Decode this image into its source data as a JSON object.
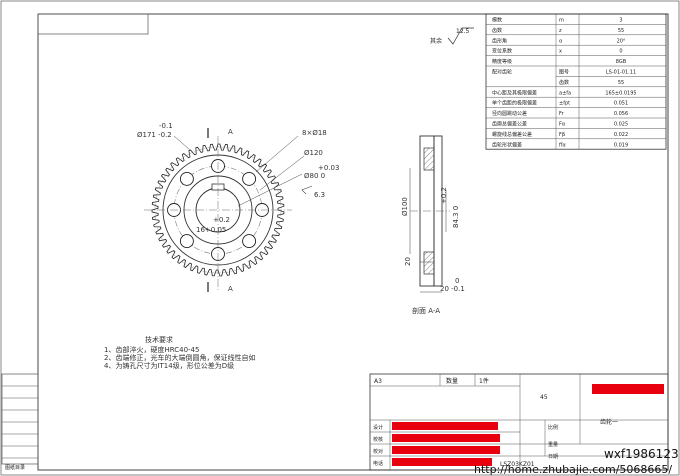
{
  "params": {
    "rows": [
      {
        "name": "模数",
        "sym": "m",
        "val": "3"
      },
      {
        "name": "齿数",
        "sym": "z",
        "val": "55"
      },
      {
        "name": "齿形角",
        "sym": "α",
        "val": "20°"
      },
      {
        "name": "变位系数",
        "sym": "x",
        "val": "0"
      },
      {
        "name": "精度等级",
        "sym": "",
        "val": "8GB"
      },
      {
        "name": "配对齿轮",
        "sym": "图号",
        "val": "LS-01-01.11"
      },
      {
        "name": "",
        "sym": "齿数",
        "val": "55"
      },
      {
        "name": "中心距及其极限偏差",
        "sym": "a±fa",
        "val": "165±0.0195"
      },
      {
        "name": "单个齿距的极限偏差",
        "sym": "±fpt",
        "val": "0.051"
      },
      {
        "name": "径向圆跳动公差",
        "sym": "Fr",
        "val": "0.056"
      },
      {
        "name": "齿廓总偏差公差",
        "sym": "Fα",
        "val": "0.025"
      },
      {
        "name": "螺旋线总偏差公差",
        "sym": "Fβ",
        "val": "0.022"
      },
      {
        "name": "齿轮形状偏差",
        "sym": "ffα",
        "val": "0.019"
      }
    ]
  },
  "surface_finish": {
    "value": "12.5",
    "label": "其余"
  },
  "front_view": {
    "section_label_top": "A",
    "section_label_bottom": "A",
    "dims": [
      "-0.1",
      "Ø171 -0.2",
      "8×Ø18",
      "Ø120",
      "+0.03",
      "Ø80  0",
      "6.3",
      "+0.2",
      "16+0.05"
    ]
  },
  "section_view": {
    "caption": "剖面 A-A",
    "dims": [
      "Ø100",
      "+0.2",
      "84.3 0",
      "20",
      "20 -0.1",
      "0"
    ]
  },
  "tech_req": {
    "title": "技术要求",
    "items": [
      "1、齿部淬火，硬度HRC40-45",
      "2、齿端修正，光车的大端倒圆角，保证线性自如",
      "4、为铸孔尺寸为IT14级，形位公差为D级"
    ]
  },
  "title_block": {
    "sheet": "A3",
    "qty_label": "数量",
    "qty_value": "1件",
    "material": "45",
    "part_name": "齿轮一",
    "drawing_no": "LSZ03KZ01",
    "labels": {
      "design": "设计",
      "check": "校核",
      "ratio": "比例",
      "weight": "重量",
      "approve": "校对",
      "phone": "电话",
      "date": "日期"
    }
  },
  "left_block": {
    "label": "图纸目录"
  },
  "watermark": {
    "line1": "wxf19861231",
    "line2": "http://home.zhubajie.com/5068665/"
  },
  "colors": {
    "redaction": "#e8000f",
    "line": "#222222",
    "frame": "#555555"
  }
}
